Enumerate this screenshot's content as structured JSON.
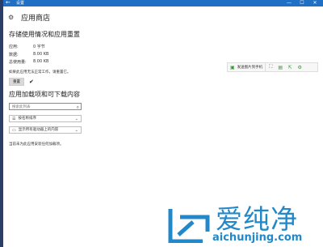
{
  "window": {
    "title": "设置",
    "back_glyph": "←",
    "controls": [
      "—",
      "☐",
      "✕"
    ]
  },
  "header": {
    "title": "应用商店"
  },
  "storage": {
    "title": "存储使用情况和应用重置",
    "rows": [
      {
        "label": "应用:",
        "value": "0 字节"
      },
      {
        "label": "数据:",
        "value": "8.00 KB"
      },
      {
        "label": "总使用量:",
        "value": "8.00 KB"
      }
    ],
    "note": "如果此应用无法正常工作，请重置它。",
    "reset_label": "重置",
    "done_glyph": "✔"
  },
  "addons": {
    "title": "应用加载项和可下载内容",
    "search_placeholder": "搜索此列表",
    "sort_label": "按名称排序",
    "filter_label": "显示所有驱动器上的内容",
    "empty_note": "当前未为此应用安装任何加载项。"
  },
  "toolbar": {
    "send_label": "发送图片到手机"
  },
  "watermark": {
    "text": "爱纯净",
    "url": "aichunjing.com"
  },
  "colors": {
    "titlebar": "#1f6fc4",
    "accent_green": "#2c9a2c",
    "watermark_blue": "#2288c9"
  }
}
